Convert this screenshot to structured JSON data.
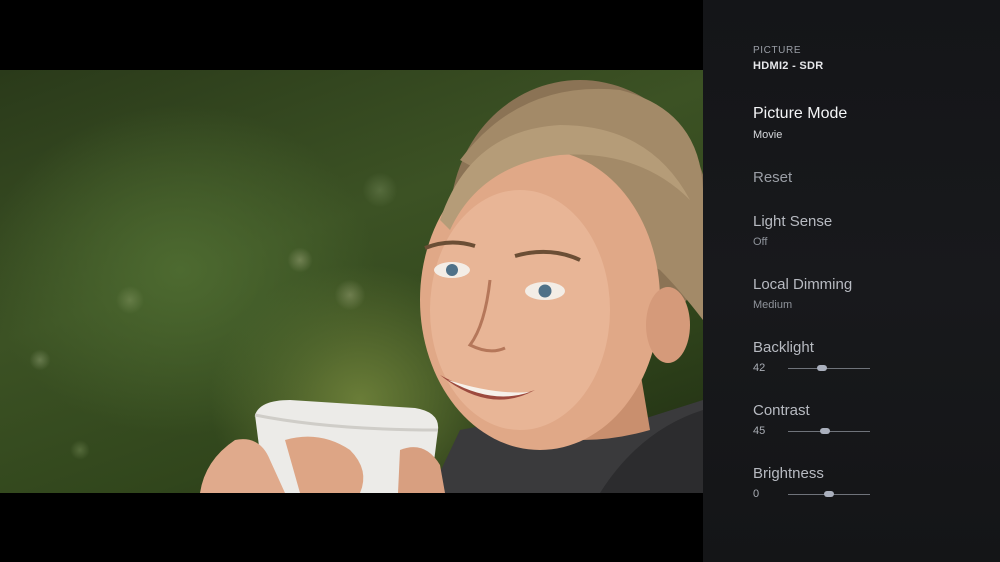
{
  "panel": {
    "section": "PICTURE",
    "source": "HDMI2 - SDR",
    "items": [
      {
        "label": "Picture Mode",
        "value": "Movie"
      },
      {
        "label": "Reset"
      },
      {
        "label": "Light Sense",
        "value": "Off"
      },
      {
        "label": "Local Dimming",
        "value": "Medium"
      },
      {
        "label": "Backlight",
        "value": "42",
        "level": 0.42
      },
      {
        "label": "Contrast",
        "value": "45",
        "level": 0.45
      },
      {
        "label": "Brightness",
        "value": "0",
        "level": 0.5
      }
    ]
  },
  "colors": {
    "panel_bg": "#17181b",
    "focus_text": "#f4f5f7",
    "slider_knob": "#aab0bd"
  }
}
